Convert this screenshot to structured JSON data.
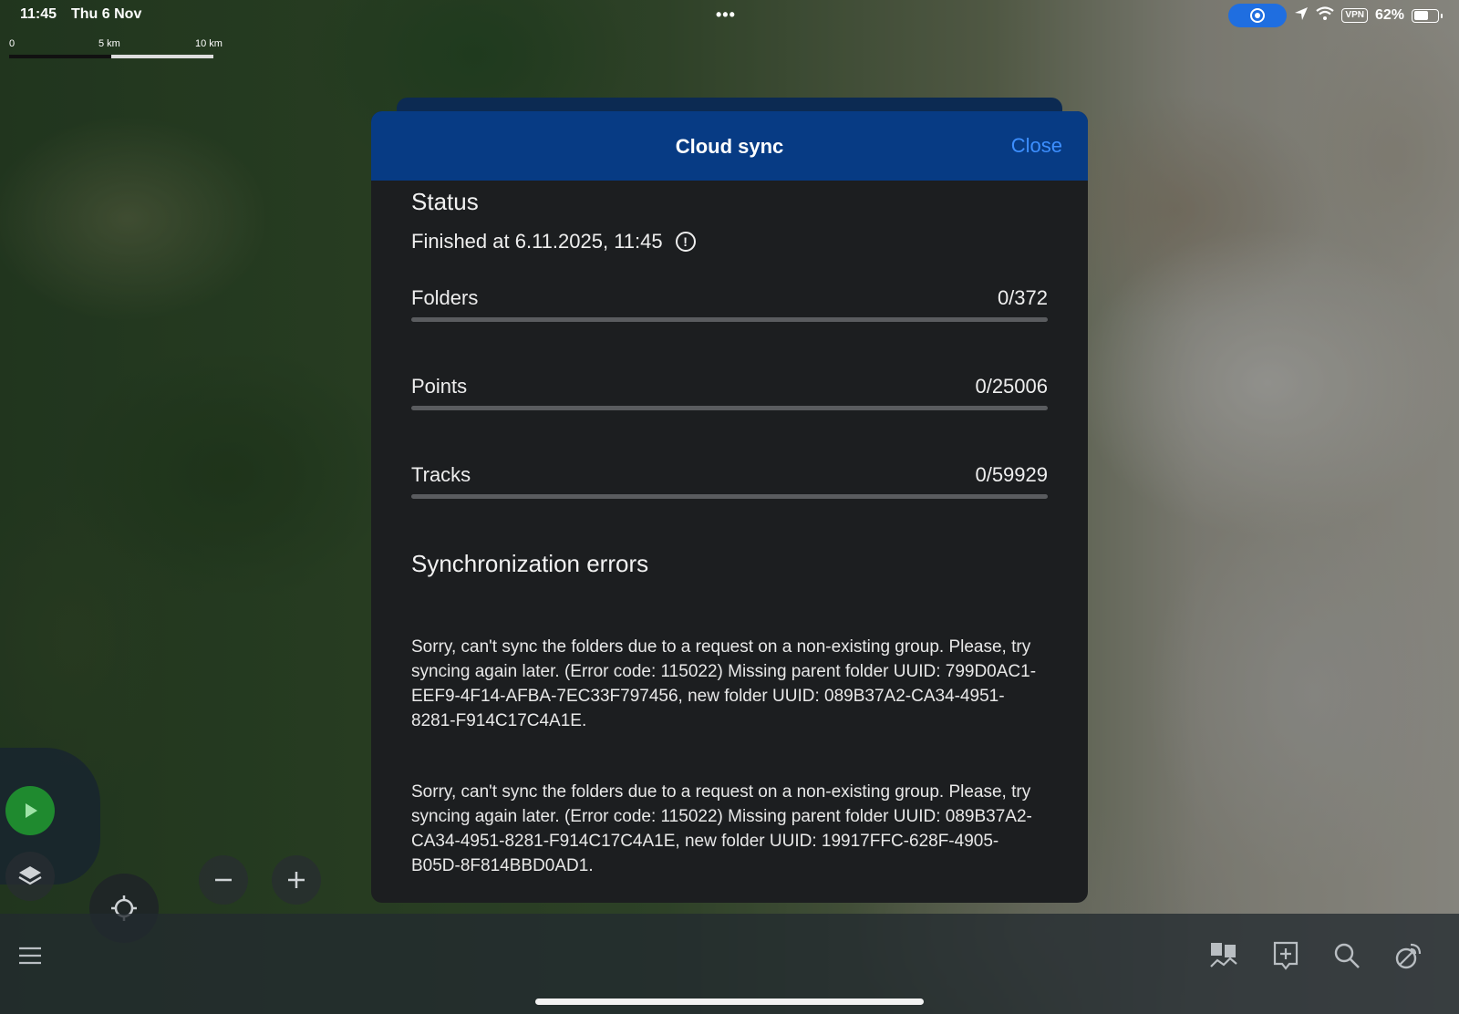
{
  "status_bar": {
    "time": "11:45",
    "date": "Thu 6 Nov",
    "battery_percent": "62%",
    "vpn_label": "VPN",
    "battery_level": 0.62
  },
  "scale_bar": {
    "labels": [
      "0",
      "5 km",
      "10 km"
    ]
  },
  "modal": {
    "title": "Cloud sync",
    "close_label": "Close",
    "status_heading": "Status",
    "finished_text": "Finished at 6.11.2025, 11:45",
    "progress": [
      {
        "label": "Folders",
        "value_text": "0/372",
        "fraction": 0
      },
      {
        "label": "Points",
        "value_text": "0/25006",
        "fraction": 0
      },
      {
        "label": "Tracks",
        "value_text": "0/59929",
        "fraction": 0
      }
    ],
    "errors_heading": "Synchronization errors",
    "errors": [
      "Sorry, can't sync the folders due to a request on a non-existing group. Please, try syncing again later. (Error code: 115022) Missing parent folder UUID: 799D0AC1-EEF9-4F14-AFBA-7EC33F797456, new folder UUID: 089B37A2-CA34-4951-8281-F914C17C4A1E.",
      "Sorry, can't sync the folders due to a request on a non-existing group. Please, try syncing again later. (Error code: 115022) Missing parent folder UUID: 089B37A2-CA34-4951-8281-F914C17C4A1E, new folder UUID: 19917FFC-628F-4905-B05D-8F814BBD0AD1."
    ]
  },
  "map_controls": [
    "play-icon",
    "layers-icon",
    "locate-icon",
    "zoom-out-icon",
    "zoom-in-icon"
  ],
  "toolbar_icons": [
    "menu-icon",
    "maps-icon",
    "add-point-icon",
    "search-icon",
    "satellite-icon"
  ],
  "colors": {
    "header": "#073b84",
    "accent": "#3d8fff",
    "play_button": "#1f8a2f",
    "modal_bg": "#1c1e20"
  }
}
